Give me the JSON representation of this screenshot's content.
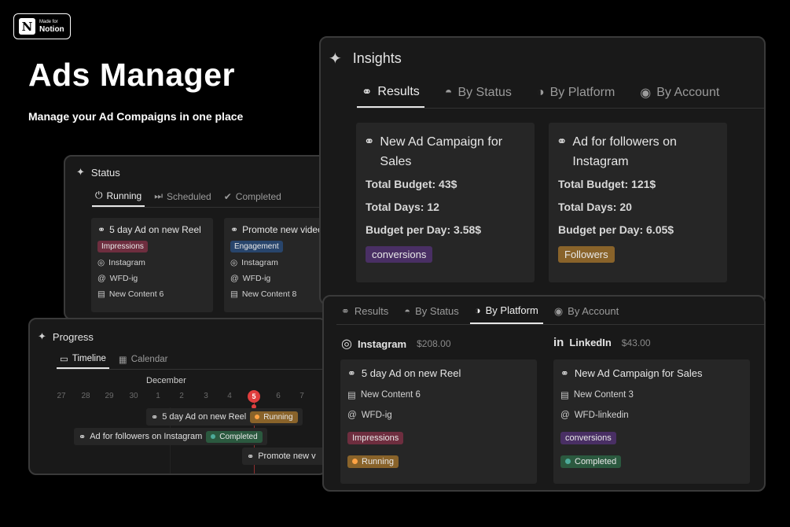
{
  "badge": {
    "line1": "Made for",
    "line2": "Notion"
  },
  "hero": {
    "title": "Ads Manager",
    "subtitle": "Manage your Ad Compaigns in one place"
  },
  "status": {
    "title": "Status",
    "tabs": [
      {
        "label": "Running"
      },
      {
        "label": "Scheduled"
      },
      {
        "label": "Completed"
      }
    ],
    "cards": [
      {
        "title": "5 day Ad on new Reel",
        "tag": "Impressions",
        "platform": "Instagram",
        "account": "WFD-ig",
        "content": "New Content 6"
      },
      {
        "title": "Promote new video",
        "tag": "Engagement",
        "platform": "Instagram",
        "account": "WFD-ig",
        "content": "New Content 8"
      }
    ]
  },
  "progress": {
    "title": "Progress",
    "tabs": [
      {
        "label": "Timeline"
      },
      {
        "label": "Calendar"
      }
    ],
    "month": "December",
    "days": [
      "27",
      "28",
      "29",
      "30",
      "1",
      "2",
      "3",
      "4",
      "5",
      "6",
      "7"
    ],
    "today": "5",
    "bars": [
      {
        "title": "5 day Ad on new Reel",
        "status": "Running"
      },
      {
        "title": "Ad for followers on Instagram",
        "status": "Completed"
      },
      {
        "title": "Promote new v"
      }
    ]
  },
  "insights": {
    "title": "Insights",
    "tabs": [
      {
        "label": "Results"
      },
      {
        "label": "By Status"
      },
      {
        "label": "By Platform"
      },
      {
        "label": "By Account"
      }
    ],
    "cards": [
      {
        "title": "New Ad Campaign for Sales",
        "budget": "Total Budget: 43$",
        "days": "Total Days: 12",
        "per_day": "Budget per Day: 3.58$",
        "tag": "conversions"
      },
      {
        "title": "Ad for followers on Instagram",
        "budget": "Total Budget: 121$",
        "days": "Total Days: 20",
        "per_day": "Budget per Day: 6.05$",
        "tag": "Followers"
      }
    ]
  },
  "platform": {
    "tabs": [
      {
        "label": "Results"
      },
      {
        "label": "By Status"
      },
      {
        "label": "By Platform"
      },
      {
        "label": "By Account"
      }
    ],
    "groups": [
      {
        "name": "Instagram",
        "amount": "$208.00",
        "card": {
          "title": "5 day Ad on new Reel",
          "content": "New Content 6",
          "account": "WFD-ig",
          "tag": "Impressions",
          "status": "Running"
        }
      },
      {
        "name": "LinkedIn",
        "amount": "$43.00",
        "card": {
          "title": "New Ad Campaign for Sales",
          "content": "New Content 3",
          "account": "WFD-linkedin",
          "tag": "conversions",
          "status": "Completed"
        }
      }
    ]
  },
  "colors": {
    "background": "#000000",
    "panel": "#191919",
    "card": "#262626",
    "today": "#e03e3e"
  }
}
